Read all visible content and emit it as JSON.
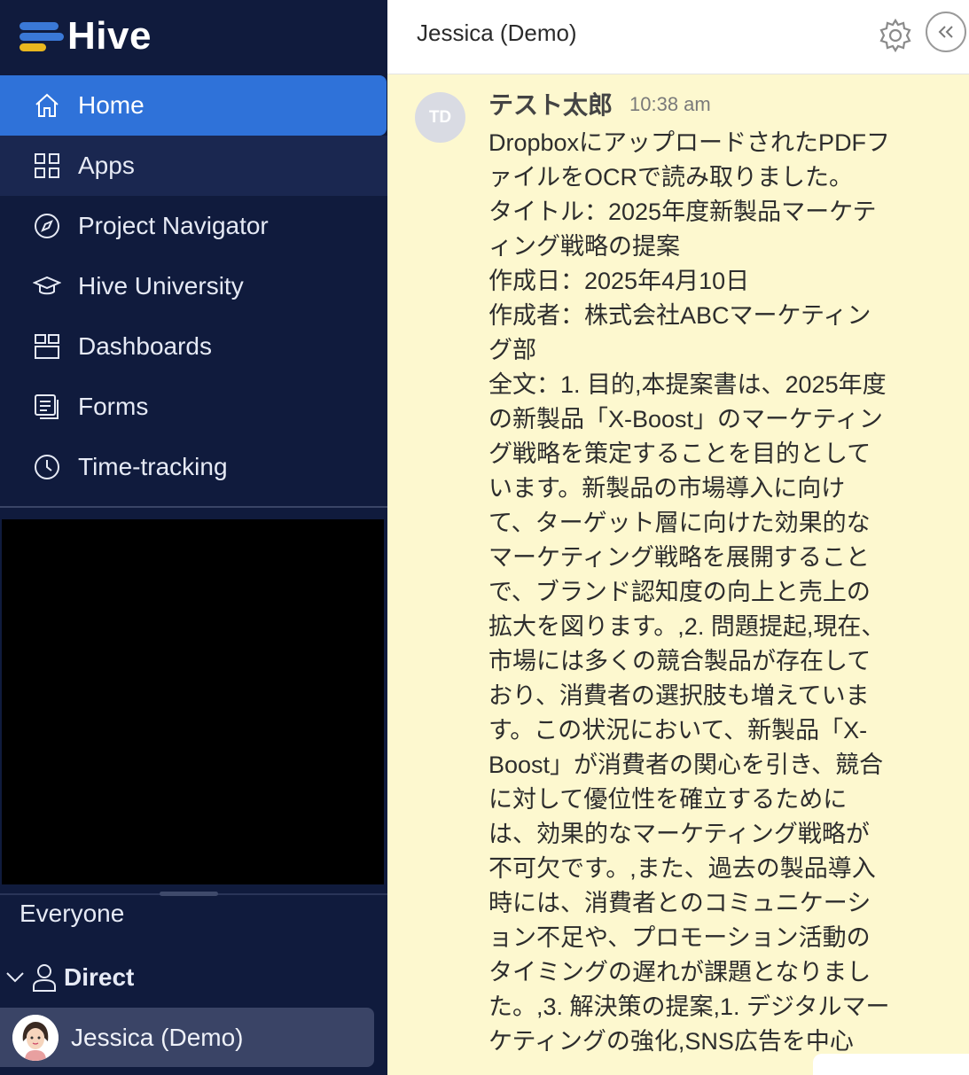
{
  "app": {
    "name": "Hive"
  },
  "sidebar": {
    "nav": [
      {
        "label": "Home",
        "icon": "home-icon",
        "active": true
      },
      {
        "label": "Apps",
        "icon": "grid-icon"
      },
      {
        "label": "Project Navigator",
        "icon": "compass-icon"
      },
      {
        "label": "Hive University",
        "icon": "graduation-cap-icon"
      },
      {
        "label": "Dashboards",
        "icon": "dashboard-icon"
      },
      {
        "label": "Forms",
        "icon": "forms-icon"
      },
      {
        "label": "Time-tracking",
        "icon": "clock-icon"
      }
    ],
    "everyone_label": "Everyone",
    "direct_label": "Direct",
    "dm_name": "Jessica (Demo)"
  },
  "header": {
    "title": "Jessica (Demo)"
  },
  "message": {
    "avatar_initials": "TD",
    "author": "テスト太郎",
    "time": "10:38 am",
    "lines": [
      "DropboxにアップロードされたPDFフ",
      "ァイルをOCRで読み取りました。",
      "タイトル：2025年度新製品マーケテ",
      "ィング戦略の提案",
      "作成日：2025年4月10日",
      "作成者：株式会社ABCマーケティン",
      "グ部",
      "全文：1. 目的,本提案書は、2025年度",
      "の新製品「X-Boost」のマーケティン",
      "グ戦略を策定することを目的として",
      "います。新製品の市場導入に向け",
      "て、ターゲット層に向けた効果的な",
      "マーケティング戦略を展開すること",
      "で、ブランド認知度の向上と売上の",
      "拡大を図ります。,2. 問題提起,現在、",
      "市場には多くの競合製品が存在して",
      "おり、消費者の選択肢も増えていま",
      "す。この状況において、新製品「X-",
      "Boost」が消費者の関心を引き、競合",
      "に対して優位性を確立するために",
      "は、効果的なマーケティング戦略が",
      "不可欠です。,また、過去の製品導入",
      "時には、消費者とのコミュニケーシ",
      "ョン不足や、プロモーション活動の",
      "タイミングの遅れが課題となりまし",
      "た。,3. 解決策の提案,1. デジタルマー",
      "ケティングの強化,SNS広告を中心"
    ]
  },
  "colors": {
    "sidebar_bg": "#101b3d",
    "active_nav": "#2f72d9",
    "message_bg": "#fdf8cf"
  }
}
